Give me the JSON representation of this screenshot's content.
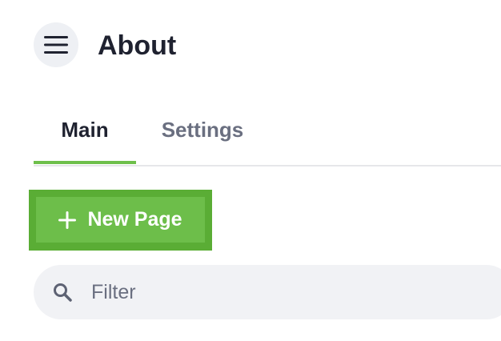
{
  "header": {
    "menu_icon": "hamburger-menu-icon",
    "title": "About"
  },
  "tabs": [
    {
      "label": "Main",
      "active": true
    },
    {
      "label": "Settings",
      "active": false
    }
  ],
  "new_page_button": {
    "icon": "plus-icon",
    "label": "New Page"
  },
  "filter": {
    "icon": "search-icon",
    "placeholder": "Filter",
    "value": ""
  },
  "colors": {
    "accent": "#6dbe4a",
    "accent_outline": "#5aad35",
    "title_text": "#1f2230",
    "muted_text": "#6a6f80",
    "input_bg": "#f1f2f5"
  }
}
